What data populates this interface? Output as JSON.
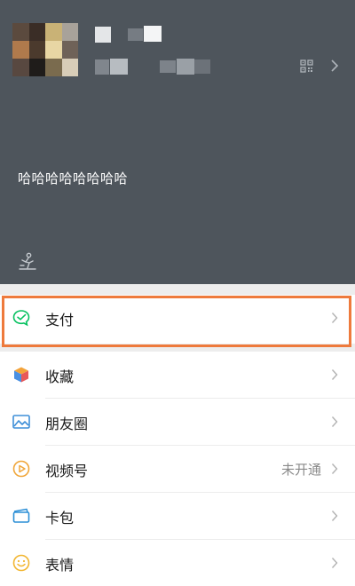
{
  "profile": {
    "status_text": "哈哈哈哈哈哈哈哈"
  },
  "menu": {
    "items": [
      {
        "label": "支付",
        "icon": "pay-icon",
        "value": ""
      },
      {
        "label": "收藏",
        "icon": "favorites-icon",
        "value": ""
      },
      {
        "label": "朋友圈",
        "icon": "moments-icon",
        "value": ""
      },
      {
        "label": "视频号",
        "icon": "channels-icon",
        "value": "未开通"
      },
      {
        "label": "卡包",
        "icon": "cards-icon",
        "value": ""
      },
      {
        "label": "表情",
        "icon": "stickers-icon",
        "value": ""
      }
    ]
  },
  "colors": {
    "header_background": "#4e555c",
    "highlight_border": "#ee7a3c",
    "pay_green": "#07c160"
  }
}
